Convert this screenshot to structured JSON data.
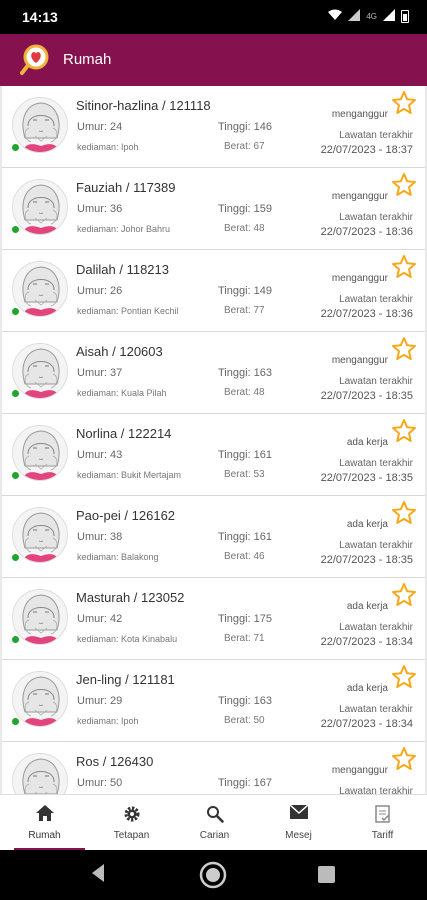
{
  "status_bar": {
    "time": "14:13",
    "network": "4G"
  },
  "app_bar": {
    "title": "Rumah"
  },
  "profiles": [
    {
      "name": "Sitinor-hazlina / 121118",
      "umur": "Umur: 24",
      "kediaman": "kediaman: Ipoh",
      "tinggi": "Tinggi: 146",
      "berat": "Berat: 67",
      "status": "menganggur",
      "lawatan": "Lawatan terakhir",
      "tarikh": "22/07/2023 - 18:37"
    },
    {
      "name": "Fauziah / 117389",
      "umur": "Umur: 36",
      "kediaman": "kediaman: Johor Bahru",
      "tinggi": "Tinggi: 159",
      "berat": "Berat: 48",
      "status": "menganggur",
      "lawatan": "Lawatan terakhir",
      "tarikh": "22/07/2023 - 18:36"
    },
    {
      "name": "Dalilah / 118213",
      "umur": "Umur: 26",
      "kediaman": "kediaman: Pontian Kechil",
      "tinggi": "Tinggi: 149",
      "berat": "Berat: 77",
      "status": "menganggur",
      "lawatan": "Lawatan terakhir",
      "tarikh": "22/07/2023 - 18:36"
    },
    {
      "name": "Aisah / 120603",
      "umur": "Umur: 37",
      "kediaman": "kediaman: Kuala Pilah",
      "tinggi": "Tinggi: 163",
      "berat": "Berat: 48",
      "status": "menganggur",
      "lawatan": "Lawatan terakhir",
      "tarikh": "22/07/2023 - 18:35"
    },
    {
      "name": "Norlina / 122214",
      "umur": "Umur: 43",
      "kediaman": "kediaman: Bukit Mertajam",
      "tinggi": "Tinggi: 161",
      "berat": "Berat: 53",
      "status": "ada kerja",
      "lawatan": "Lawatan terakhir",
      "tarikh": "22/07/2023 - 18:35"
    },
    {
      "name": "Pao-pei / 126162",
      "umur": "Umur: 38",
      "kediaman": "kediaman: Balakong",
      "tinggi": "Tinggi: 161",
      "berat": "Berat: 46",
      "status": "ada kerja",
      "lawatan": "Lawatan terakhir",
      "tarikh": "22/07/2023 - 18:35"
    },
    {
      "name": "Masturah / 123052",
      "umur": "Umur: 42",
      "kediaman": "kediaman: Kota Kinabalu",
      "tinggi": "Tinggi: 175",
      "berat": "Berat: 71",
      "status": "ada kerja",
      "lawatan": "Lawatan terakhir",
      "tarikh": "22/07/2023 - 18:34"
    },
    {
      "name": "Jen-ling / 121181",
      "umur": "Umur: 29",
      "kediaman": "kediaman: Ipoh",
      "tinggi": "Tinggi: 163",
      "berat": "Berat: 50",
      "status": "ada kerja",
      "lawatan": "Lawatan terakhir",
      "tarikh": "22/07/2023 - 18:34"
    },
    {
      "name": "Ros / 126430",
      "umur": "Umur: 50",
      "kediaman": "",
      "tinggi": "Tinggi: 167",
      "berat": "",
      "status": "menganggur",
      "lawatan": "Lawatan terakhir",
      "tarikh": ""
    }
  ],
  "bottom_nav": {
    "tabs": [
      {
        "label": "Rumah",
        "icon": "home-icon"
      },
      {
        "label": "Tetapan",
        "icon": "gear-icon"
      },
      {
        "label": "Carian",
        "icon": "search-icon"
      },
      {
        "label": "Mesej",
        "icon": "envelope-icon"
      },
      {
        "label": "Tariff",
        "icon": "document-icon"
      }
    ]
  },
  "colors": {
    "brand": "#85124e",
    "star": "#f7a81b",
    "online": "#22a52e",
    "avatar_shirt": "#e2457d"
  }
}
